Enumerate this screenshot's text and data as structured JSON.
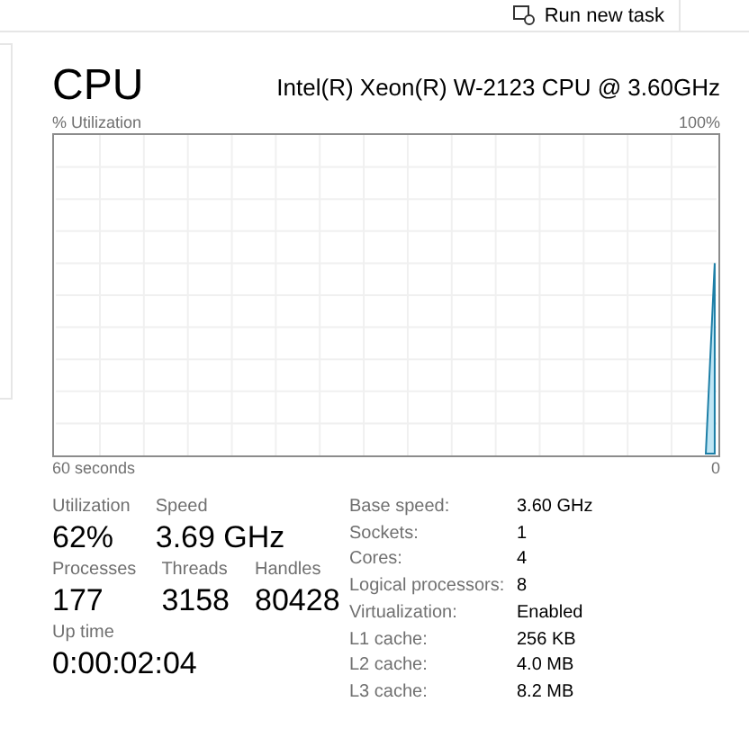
{
  "toolbar": {
    "run_new_task": "Run new task"
  },
  "title": "CPU",
  "model": "Intel(R) Xeon(R) W-2123 CPU @ 3.60GHz",
  "graph": {
    "y_label": "% Utilization",
    "y_max": "100%",
    "x_label": "60 seconds",
    "x_min": "0"
  },
  "stats": [
    [
      {
        "label": "Utilization",
        "value": "62%"
      },
      {
        "label": "Speed",
        "value": "3.69 GHz"
      }
    ],
    [
      {
        "label": "Processes",
        "value": "177"
      },
      {
        "label": "Threads",
        "value": "3158"
      },
      {
        "label": "Handles",
        "value": "80428"
      }
    ],
    [
      {
        "label": "Up time",
        "value": "0:00:02:04"
      }
    ]
  ],
  "details": [
    {
      "label": "Base speed:",
      "value": "3.60 GHz"
    },
    {
      "label": "Sockets:",
      "value": "1"
    },
    {
      "label": "Cores:",
      "value": "4"
    },
    {
      "label": "Logical processors:",
      "value": "8"
    },
    {
      "label": "Virtualization:",
      "value": "Enabled"
    },
    {
      "label": "L1 cache:",
      "value": "256 KB"
    },
    {
      "label": "L2 cache:",
      "value": "4.0 MB"
    },
    {
      "label": "L3 cache:",
      "value": "8.2 MB"
    }
  ]
}
